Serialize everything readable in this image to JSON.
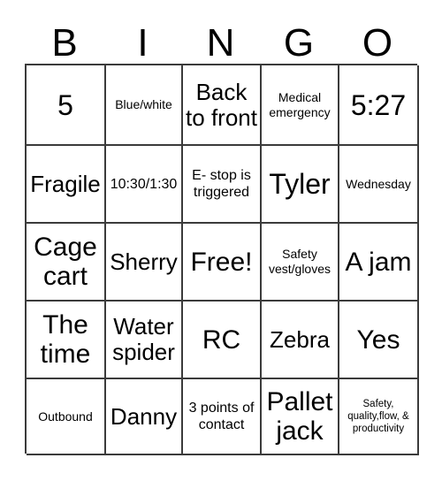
{
  "card": {
    "title_letters": [
      "B",
      "I",
      "N",
      "G",
      "O"
    ],
    "free_space_label": "Free!",
    "grid": {
      "columns": 5,
      "rows": 5,
      "cells": [
        [
          {
            "text": "5",
            "size": "xl"
          },
          {
            "text": "Blue/white",
            "size": "xs"
          },
          {
            "text": "Back to front",
            "size": "md"
          },
          {
            "text": "Medical emergency",
            "size": "xs"
          },
          {
            "text": "5:27",
            "size": "xl"
          }
        ],
        [
          {
            "text": "Fragile",
            "size": "md"
          },
          {
            "text": "10:30/1:30",
            "size": "sm"
          },
          {
            "text": "E- stop is triggered",
            "size": "sm"
          },
          {
            "text": "Tyler",
            "size": "xl"
          },
          {
            "text": "Wednesday",
            "size": "xs"
          }
        ],
        [
          {
            "text": "Cage cart",
            "size": "lg"
          },
          {
            "text": "Sherry",
            "size": "md"
          },
          {
            "text": "Free!",
            "size": "lg"
          },
          {
            "text": "Safety vest/gloves",
            "size": "xs"
          },
          {
            "text": "A jam",
            "size": "lg"
          }
        ],
        [
          {
            "text": "The time",
            "size": "lg"
          },
          {
            "text": "Water spider",
            "size": "md"
          },
          {
            "text": "RC",
            "size": "lg"
          },
          {
            "text": "Zebra",
            "size": "md"
          },
          {
            "text": "Yes",
            "size": "lg"
          }
        ],
        [
          {
            "text": "Outbound",
            "size": "xs"
          },
          {
            "text": "Danny",
            "size": "md"
          },
          {
            "text": "3 points of contact",
            "size": "sm"
          },
          {
            "text": "Pallet jack",
            "size": "lg"
          },
          {
            "text": "Safety, quality,flow, & productivity",
            "size": "xxs"
          }
        ]
      ]
    },
    "colors": {
      "background": "#ffffff",
      "text": "#000000",
      "grid_line": "#3b3b3b"
    }
  }
}
